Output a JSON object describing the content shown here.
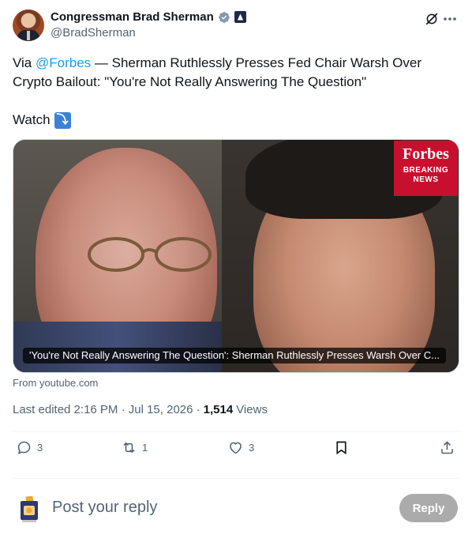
{
  "author": {
    "display_name": "Congressman Brad Sherman",
    "handle": "@BradSherman"
  },
  "tweet": {
    "prefix": "Via ",
    "mention": "@Forbes",
    "dash": " —  ",
    "body": "Sherman Ruthlessly Presses Fed Chair Warsh Over Crypto Bailout: \"You're Not Really Answering The Question\"",
    "watch_label": "Watch",
    "watch_emoji": "⤵"
  },
  "media": {
    "badge_logo": "Forbes",
    "badge_line1": "BREAKING",
    "badge_line2": "NEWS",
    "caption": "'You're Not Really Answering The Question': Sherman Ruthlessly Presses Warsh Over C..."
  },
  "source": "From youtube.com",
  "meta": {
    "edited_label": "Last edited 2:16 PM · Jul 15, 2026 ·",
    "views_count": "1,514",
    "views_label": "Views"
  },
  "actions": {
    "replies": "3",
    "reposts": "1",
    "likes": "3"
  },
  "reply": {
    "placeholder": "Post your reply",
    "button_label": "Reply"
  },
  "icons": {
    "verified": "verified-badge-icon",
    "government": "government-badge-icon",
    "grok": "grok-icon",
    "more": "more-icon",
    "watch": "arrow-down-right-emoji",
    "reply": "comment-icon",
    "repost": "repost-icon",
    "like": "heart-icon",
    "bookmark": "bookmark-icon",
    "share": "share-icon"
  },
  "colors": {
    "link": "#1d9bf0",
    "verified": "#829aab",
    "forbes_red": "#c8102e",
    "muted_text": "#536471"
  }
}
